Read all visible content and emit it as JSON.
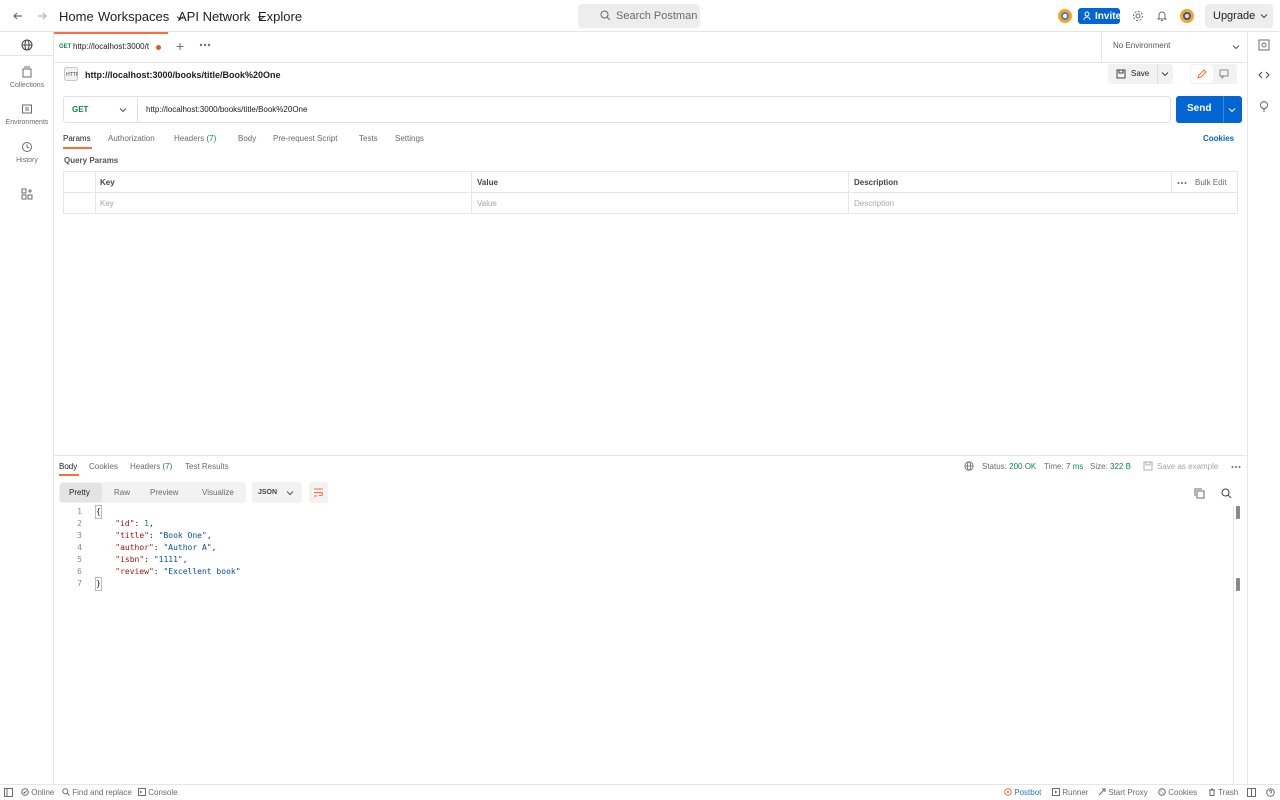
{
  "topbar": {
    "home": "Home",
    "workspaces": "Workspaces",
    "api_network": "API Network",
    "explore": "Explore",
    "search_placeholder": "Search Postman",
    "invite": "Invite",
    "upgrade": "Upgrade"
  },
  "sidebar": {
    "items": [
      {
        "label": "Collections",
        "icon": "collections-icon"
      },
      {
        "label": "Environments",
        "icon": "environments-icon"
      },
      {
        "label": "History",
        "icon": "history-icon"
      }
    ]
  },
  "tabs": {
    "active_method": "GET",
    "active_url": "http://localhost:3000/t",
    "environment": "No Environment"
  },
  "request": {
    "title": "http://localhost:3000/books/title/Book%20One",
    "save": "Save",
    "method": "GET",
    "url": "http://localhost:3000/books/title/Book%20One",
    "send": "Send",
    "tabs": [
      "Params",
      "Authorization",
      "Headers",
      "Body",
      "Pre-request Script",
      "Tests",
      "Settings"
    ],
    "headers_count": "(7)",
    "cookies": "Cookies",
    "query_params_label": "Query Params",
    "table": {
      "col_key": "Key",
      "col_value": "Value",
      "col_description": "Description",
      "bulk_edit": "Bulk Edit",
      "ph_key": "Key",
      "ph_value": "Value",
      "ph_description": "Description"
    }
  },
  "response": {
    "tabs": [
      "Body",
      "Cookies",
      "Headers",
      "Test Results"
    ],
    "headers_count": "(7)",
    "status_label": "Status:",
    "status_value": "200 OK",
    "time_label": "Time:",
    "time_value": "7 ms",
    "size_label": "Size:",
    "size_value": "322 B",
    "save_example": "Save as example",
    "views": [
      "Pretty",
      "Raw",
      "Preview",
      "Visualize"
    ],
    "format": "JSON",
    "body": {
      "id": 1,
      "title": "Book One",
      "author": "Author A",
      "isbn": "1111",
      "review": "Excellent book"
    }
  },
  "bottombar": {
    "online": "Online",
    "find_replace": "Find and replace",
    "console": "Console",
    "postbot": "Postbot",
    "runner": "Runner",
    "start_proxy": "Start Proxy",
    "cookies": "Cookies",
    "trash": "Trash"
  },
  "colors": {
    "accent": "#ff6c37",
    "primary": "#0265d2",
    "get": "#0a8a3e",
    "status_ok": "#0a8a3e"
  }
}
